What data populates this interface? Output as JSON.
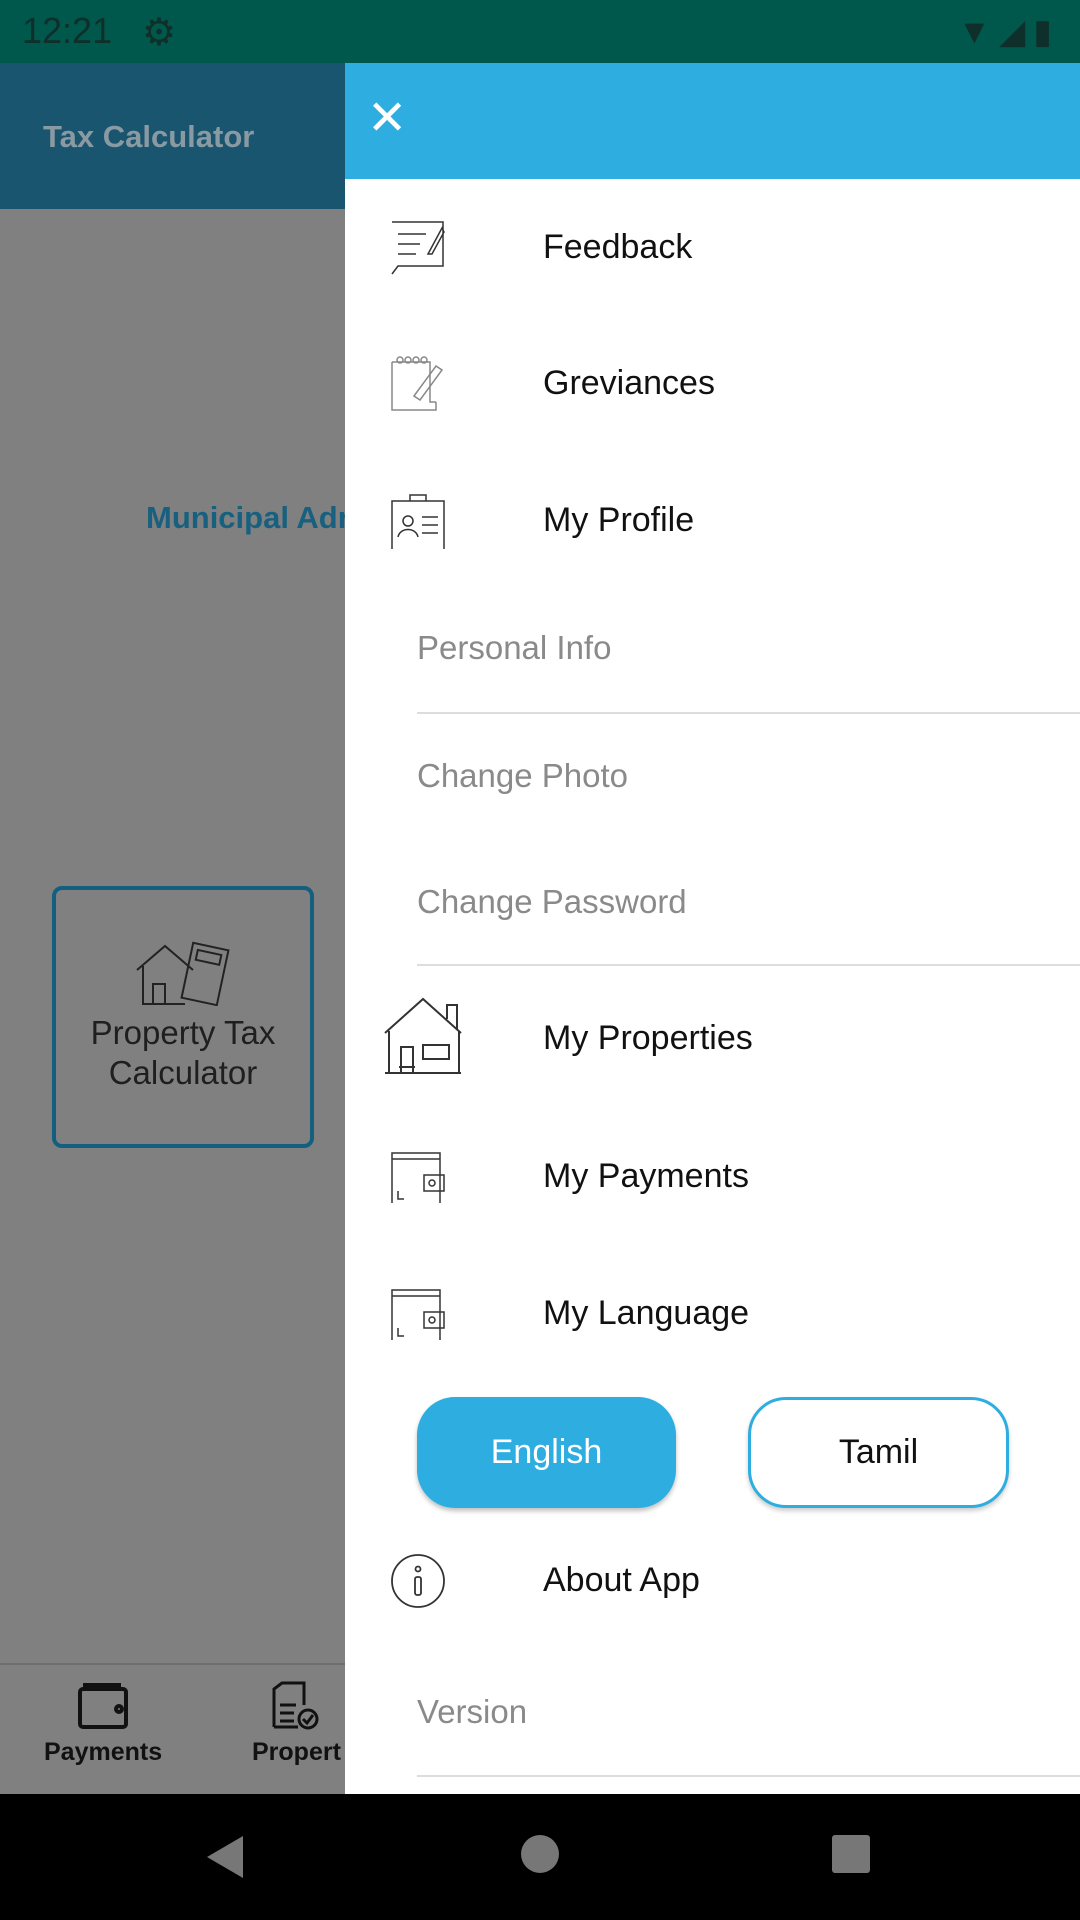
{
  "status": {
    "time": "12:21"
  },
  "background": {
    "app_title": "Tax Calculator",
    "heading": "Municipal Adr",
    "card_label": "Property Tax Calculator",
    "bottom_nav": [
      {
        "label": "Payments"
      },
      {
        "label": "Propert"
      }
    ]
  },
  "drawer": {
    "items": [
      {
        "label": "Feedback",
        "icon": "feedback-icon"
      },
      {
        "label": "Greviances",
        "icon": "notepad-icon"
      },
      {
        "label": "My Profile",
        "icon": "profile-card-icon"
      },
      {
        "label": "My Properties",
        "icon": "house-icon"
      },
      {
        "label": "My Payments",
        "icon": "wallet-icon"
      },
      {
        "label": "My Language",
        "icon": "wallet-icon"
      },
      {
        "label": "About App",
        "icon": "info-icon"
      }
    ],
    "profile_sub": [
      "Personal Info",
      "Change Photo",
      "Change Password"
    ],
    "languages": {
      "selected": "English",
      "options": [
        "English",
        "Tamil"
      ]
    },
    "version_label": "Version"
  },
  "colors": {
    "accent": "#2EAEE0",
    "status_bar": "#00574B",
    "app_bar": "#1A5570"
  }
}
